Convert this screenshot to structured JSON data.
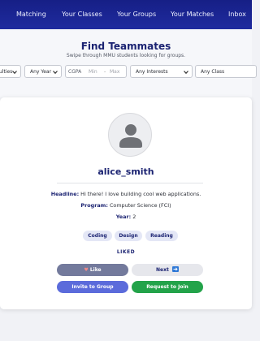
{
  "nav": {
    "items": [
      "Matching",
      "Your Classes",
      "Your Groups",
      "Your Matches",
      "Inbox"
    ]
  },
  "header": {
    "title": "Find Teammates",
    "subtitle": "Swipe through MMU students looking for groups."
  },
  "filters": {
    "faculty_value": "ulties",
    "year_value": "Any Year",
    "cgpa_label": "CGPA",
    "cgpa_min_placeholder": "Min",
    "cgpa_max_placeholder": "Max",
    "cgpa_separator": "-",
    "interests_value": "Any Interests",
    "class_value": "Any Class"
  },
  "profile": {
    "username": "alice_smith",
    "headline_label": "Headline:",
    "headline_value": "Hi there! I love building cool web applications.",
    "program_label": "Program:",
    "program_value": "Computer Science (FCI)",
    "year_label": "Year:",
    "year_value": "2",
    "tags": [
      "Coding",
      "Design",
      "Reading"
    ],
    "status": "LIKED"
  },
  "actions": {
    "like_icon": "heart-icon",
    "like_label": "Like",
    "next_label": "Next",
    "next_icon": "next-key-icon",
    "invite_label": "Invite to Group",
    "join_label": "Request to Join"
  },
  "colors": {
    "nav_bg": "#1a2390",
    "title": "#1b2372",
    "like_btn": "#737a9c",
    "invite_btn": "#5b6bdb",
    "join_btn": "#23a34a"
  }
}
